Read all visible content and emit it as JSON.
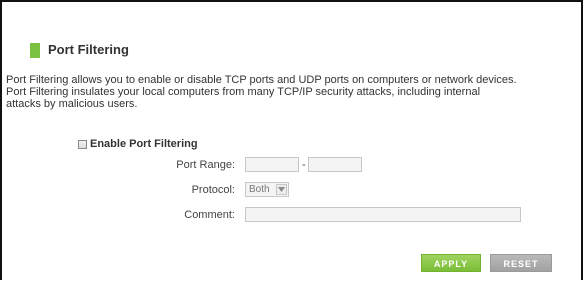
{
  "section": {
    "title": "Port Filtering",
    "accent_color": "#7bc243"
  },
  "description": {
    "line1": "Port Filtering allows you to enable or disable TCP ports and UDP ports on computers or network devices.",
    "line2": "Port Filtering insulates your local computers from many TCP/IP security attacks, including internal",
    "line3": "attacks by malicious users."
  },
  "enable": {
    "label": "Enable Port Filtering",
    "checked": false
  },
  "port_range": {
    "label": "Port Range:",
    "start_value": "",
    "separator": "-",
    "end_value": ""
  },
  "protocol": {
    "label": "Protocol:",
    "selected": "Both",
    "arrow_icon": "chevron-down-icon"
  },
  "comment": {
    "label": "Comment:",
    "value": ""
  },
  "buttons": {
    "apply": "APPLY",
    "reset": "RESET",
    "apply_color": "#7bbd37",
    "reset_color": "#a1a1a1"
  }
}
